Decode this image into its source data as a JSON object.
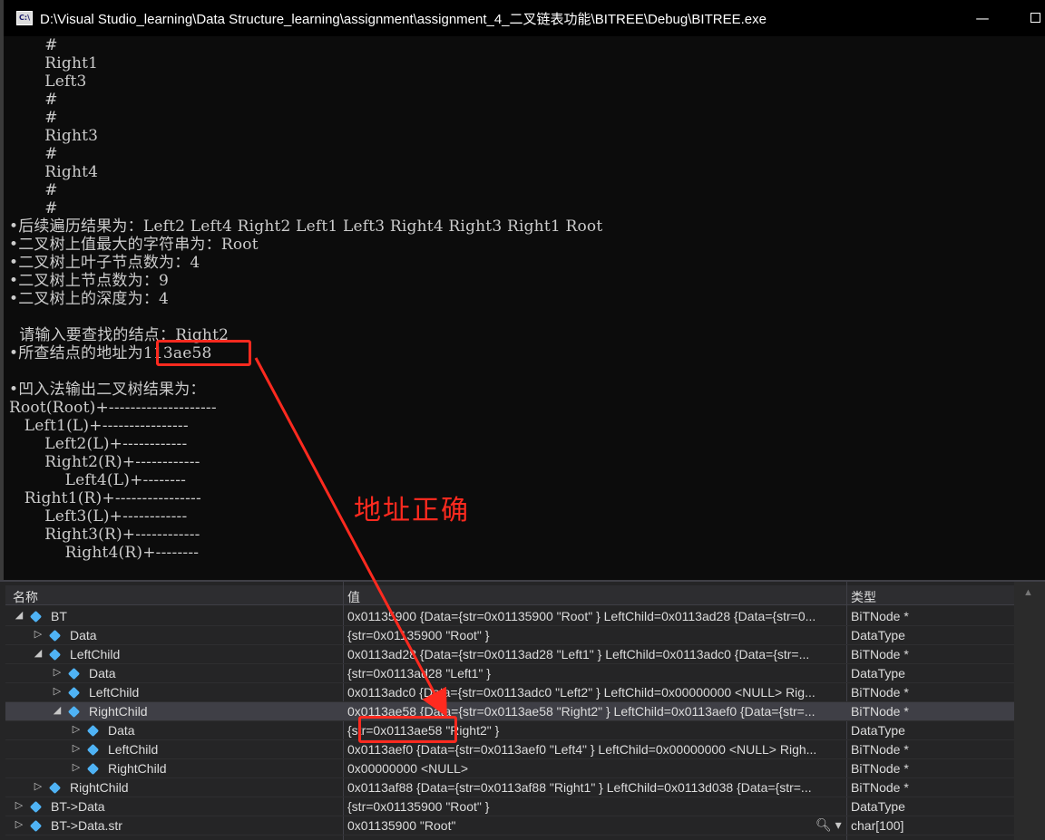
{
  "window": {
    "title": "D:\\Visual Studio_learning\\Data Structure_learning\\assignment\\assignment_4_二叉链表功能\\BITREE\\Debug\\BITREE.exe",
    "icon_label": "C:\\",
    "minimize_glyph": "—",
    "maximize_glyph": ""
  },
  "console_lines": [
    "       #",
    "       Right1",
    "       Left3",
    "       #",
    "       #",
    "       Right3",
    "       #",
    "       Right4",
    "       #",
    "       #",
    "•后续遍历结果为：Left2 Left4 Right2 Left1 Left3 Right4 Right3 Right1 Root",
    "•二叉树上值最大的字符串为：Root",
    "•二叉树上叶子节点数为：4",
    "•二叉树上节点数为：9",
    "•二叉树上的深度为：4",
    "",
    "  请输入要查找的结点：Right2",
    "•所查结点的地址为113ae58",
    "",
    "•凹入法输出二叉树结果为：",
    "Root(Root)+--------------------",
    "   Left1(L)+----------------",
    "       Left2(L)+------------",
    "       Right2(R)+------------",
    "           Left4(L)+--------",
    "   Right1(R)+----------------",
    "       Left3(L)+------------",
    "       Right3(R)+------------",
    "           Right4(R)+--------"
  ],
  "annotation": "地址正确",
  "watch": {
    "headers": {
      "name": "名称",
      "value": "值",
      "type": "类型"
    },
    "rows": [
      {
        "name": "BT",
        "value": "0x01135900 {Data={str=0x01135900 \"Root\" } LeftChild=0x0113ad28 {Data={str=0...",
        "type": "BiTNode *",
        "expander": "◢"
      },
      {
        "name": "Data",
        "value": "{str=0x01135900 \"Root\" }",
        "type": "DataType",
        "expander": "▷"
      },
      {
        "name": "LeftChild",
        "value": "0x0113ad28 {Data={str=0x0113ad28 \"Left1\" } LeftChild=0x0113adc0 {Data={str=...",
        "type": "BiTNode *",
        "expander": "◢"
      },
      {
        "name": "Data",
        "value": "{str=0x0113ad28 \"Left1\" }",
        "type": "DataType",
        "expander": "▷"
      },
      {
        "name": "LeftChild",
        "value": "0x0113adc0 {Data={str=0x0113adc0 \"Left2\" } LeftChild=0x00000000 <NULL> Rig...",
        "type": "BiTNode *",
        "expander": "▷"
      },
      {
        "name": "RightChild",
        "value": "0x0113ae58 {Data={str=0x0113ae58 \"Right2\" } LeftChild=0x0113aef0 {Data={str=...",
        "type": "BiTNode *",
        "expander": "◢"
      },
      {
        "name": "Data",
        "value": "{str=0x0113ae58 \"Right2\" }",
        "type": "DataType",
        "expander": "▷"
      },
      {
        "name": "LeftChild",
        "value": "0x0113aef0 {Data={str=0x0113aef0 \"Left4\" } LeftChild=0x00000000 <NULL> Righ...",
        "type": "BiTNode *",
        "expander": "▷"
      },
      {
        "name": "RightChild",
        "value": "0x00000000 <NULL>",
        "type": "BiTNode *",
        "expander": "▷"
      },
      {
        "name": "RightChild",
        "value": "0x0113af88 {Data={str=0x0113af88 \"Right1\" } LeftChild=0x0113d038 {Data={str=...",
        "type": "BiTNode *",
        "expander": "▷"
      },
      {
        "name": "BT->Data",
        "value": "{str=0x01135900 \"Root\" }",
        "type": "DataType",
        "expander": "▷"
      },
      {
        "name": "BT->Data.str",
        "value": "0x01135900 \"Root\"",
        "type": "char[100]",
        "expander": "▷"
      }
    ]
  },
  "colors": {
    "highlight": "#ff2a1f",
    "console_bg": "#0c0c0c",
    "panel_bg": "#252526",
    "node_icon": "#4fb3f5"
  }
}
